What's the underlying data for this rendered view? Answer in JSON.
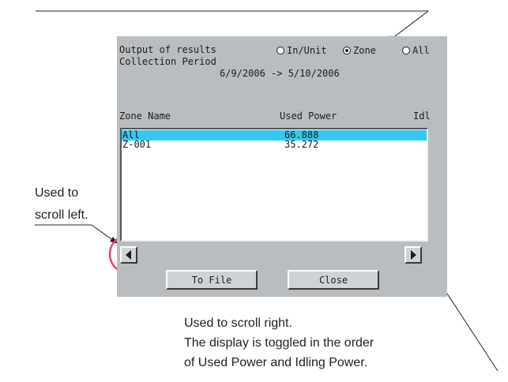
{
  "window": {
    "output_label": "Output of results",
    "collection_label": "Collection Period",
    "period": "6/9/2006 -> 5/10/2006",
    "radios": [
      {
        "label": "In/Unit",
        "selected": false
      },
      {
        "label": "Zone",
        "selected": true
      },
      {
        "label": "All",
        "selected": false
      }
    ],
    "columns": {
      "name": "Zone Name",
      "power": "Used Power",
      "idle": "Idl"
    },
    "rows": [
      {
        "name": "All",
        "power": "66.888",
        "selected": true
      },
      {
        "name": "Z-001",
        "power": "35.272",
        "selected": false
      }
    ],
    "buttons": {
      "to_file": "To File",
      "close": "Close"
    },
    "scroll_left_icon": "triangle-left-icon",
    "scroll_right_icon": "triangle-right-icon",
    "highlight_color": "#34c8ec",
    "callout_color": "#e0457b"
  },
  "annotations": {
    "left_line1": "Used to",
    "left_line2": "scroll left.",
    "right_line1": "Used to scroll right.",
    "right_line2": "The display is toggled in the order",
    "right_line3": "of Used Power and Idling Power."
  }
}
